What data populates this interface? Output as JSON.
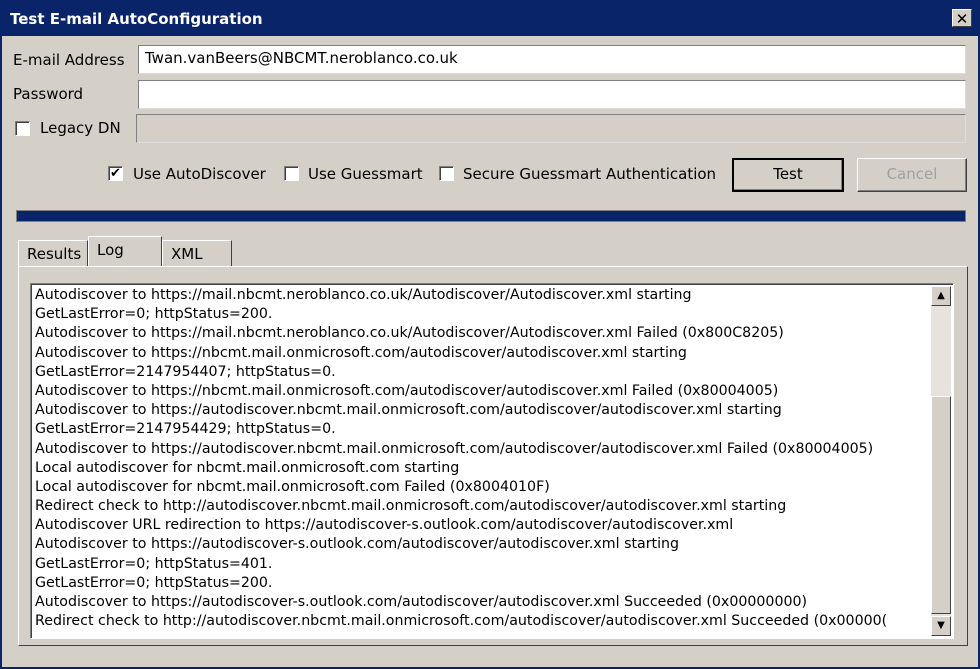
{
  "window": {
    "title": "Test E-mail AutoConfiguration",
    "close_label": "✕"
  },
  "form": {
    "email_label": "E-mail Address",
    "email_value": "Twan.vanBeers@NBCMT.neroblanco.co.uk",
    "password_label": "Password",
    "password_value": "",
    "legacy_dn_label": "Legacy DN",
    "legacy_dn_checked": false,
    "legacy_dn_value": ""
  },
  "options": {
    "use_autodiscover_label": "Use AutoDiscover",
    "use_autodiscover_checked": true,
    "use_guessmart_label": "Use Guessmart",
    "use_guessmart_checked": false,
    "secure_guessmart_label": "Secure Guessmart Authentication",
    "secure_guessmart_checked": false
  },
  "buttons": {
    "test_label": "Test",
    "cancel_label": "Cancel"
  },
  "progress": 1.0,
  "tabs": [
    {
      "label": "Results"
    },
    {
      "label": "Log"
    },
    {
      "label": "XML"
    }
  ],
  "active_tab": "Log",
  "log_lines": [
    "Autodiscover to https://mail.nbcmt.neroblanco.co.uk/Autodiscover/Autodiscover.xml starting",
    "GetLastError=0; httpStatus=200.",
    "Autodiscover to https://mail.nbcmt.neroblanco.co.uk/Autodiscover/Autodiscover.xml Failed (0x800C8205)",
    "Autodiscover to https://nbcmt.mail.onmicrosoft.com/autodiscover/autodiscover.xml starting",
    "GetLastError=2147954407; httpStatus=0.",
    "Autodiscover to https://nbcmt.mail.onmicrosoft.com/autodiscover/autodiscover.xml Failed (0x80004005)",
    "Autodiscover to https://autodiscover.nbcmt.mail.onmicrosoft.com/autodiscover/autodiscover.xml starting",
    "GetLastError=2147954429; httpStatus=0.",
    "Autodiscover to https://autodiscover.nbcmt.mail.onmicrosoft.com/autodiscover/autodiscover.xml Failed (0x80004005)",
    "Local autodiscover for nbcmt.mail.onmicrosoft.com starting",
    "Local autodiscover for nbcmt.mail.onmicrosoft.com Failed (0x8004010F)",
    "Redirect check to http://autodiscover.nbcmt.mail.onmicrosoft.com/autodiscover/autodiscover.xml starting",
    "Autodiscover URL redirection to https://autodiscover-s.outlook.com/autodiscover/autodiscover.xml",
    "Autodiscover to https://autodiscover-s.outlook.com/autodiscover/autodiscover.xml starting",
    "GetLastError=0; httpStatus=401.",
    "GetLastError=0; httpStatus=200.",
    "Autodiscover to https://autodiscover-s.outlook.com/autodiscover/autodiscover.xml Succeeded (0x00000000)",
    "Redirect check to http://autodiscover.nbcmt.mail.onmicrosoft.com/autodiscover/autodiscover.xml Succeeded (0x00000("
  ],
  "scrollbar": {
    "up_icon": "▲",
    "down_icon": "▼"
  }
}
